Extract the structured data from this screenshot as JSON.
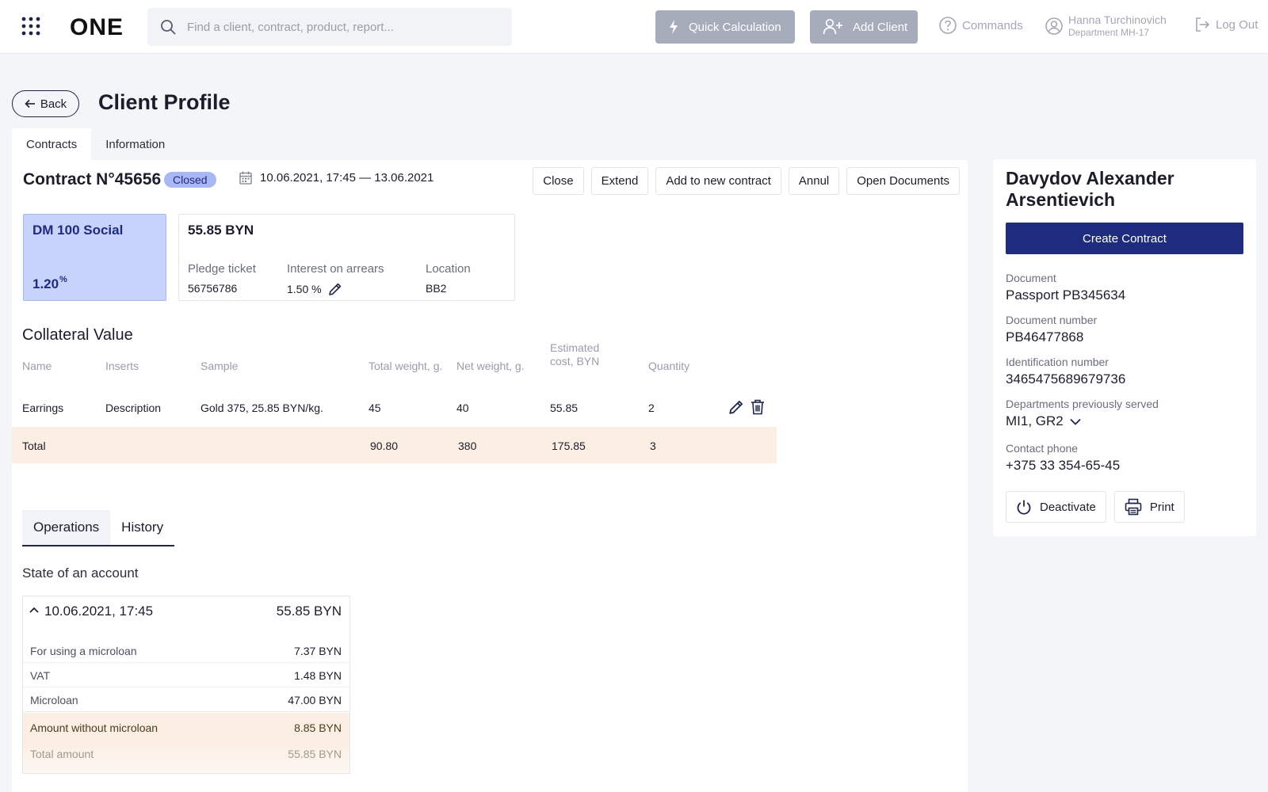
{
  "header": {
    "logo": "ONE",
    "search_placeholder": "Find a client, contract, product, report...",
    "quick_calc": "Quick Calculation",
    "add_client": "Add Client",
    "commands": "Commands",
    "user_name": "Hanna Turchinovich",
    "user_dept": "Department MH-17",
    "logout": "Log Out"
  },
  "page": {
    "back": "Back",
    "title": "Client Profile",
    "tabs": [
      "Contracts",
      "Information"
    ]
  },
  "contract": {
    "title": "Contract N°45656",
    "status": "Closed",
    "dates": "10.06.2021, 17:45 — 13.06.2021",
    "actions": [
      "Close",
      "Extend",
      "Add to new contract",
      "Annul",
      "Open Documents"
    ],
    "product_name": "DM 100 Social",
    "product_rate": "1.20",
    "product_rate_unit": "%",
    "amount": "55.85 BYN",
    "pledge_label": "Pledge ticket",
    "pledge_value": "56756786",
    "interest_label": "Interest on arrears",
    "interest_value": "1.50 %",
    "location_label": "Location",
    "location_value": "BB2"
  },
  "collateral": {
    "title": "Collateral Value",
    "columns": [
      "Name",
      "Inserts",
      "Sample",
      "Total weight, g.",
      "Net weight, g.",
      "Estimated",
      "cost, BYN",
      "Quantity"
    ],
    "rows": [
      {
        "name": "Earrings",
        "inserts": "Description",
        "sample": "Gold 375, 25.85 BYN/kg.",
        "total_weight": "45",
        "net_weight": "40",
        "cost": "55.85",
        "quantity": "2"
      }
    ],
    "total": {
      "label": "Total",
      "total_weight": "90.80",
      "net_weight": "380",
      "cost": "175.85",
      "quantity": "3"
    }
  },
  "operations": {
    "tabs": [
      "Operations",
      "History"
    ],
    "state_title": "State of an account",
    "entry_date": "10.06.2021, 17:45",
    "entry_amount": "55.85 BYN",
    "lines": [
      {
        "label": "For using a microloan",
        "value": "7.37 BYN"
      },
      {
        "label": "VAT",
        "value": "1.48 BYN"
      },
      {
        "label": "Microloan",
        "value": "47.00 BYN"
      },
      {
        "label": "Amount without microloan",
        "value": "8.85 BYN"
      },
      {
        "label": "Total amount",
        "value": "55.85 BYN"
      }
    ]
  },
  "client": {
    "name": "Davydov Alexander Arsentievich",
    "create_contract": "Create Contract",
    "fields": [
      {
        "label": "Document",
        "value": "Passport PB345634"
      },
      {
        "label": "Document number",
        "value": "PB46477868"
      },
      {
        "label": "Identification number",
        "value": "3465475689679736"
      },
      {
        "label": "Departments previously served",
        "value": "MI1, GR2"
      },
      {
        "label": "Contact phone",
        "value": "+375 33 354-65-45"
      }
    ],
    "deactivate": "Deactivate",
    "print": "Print"
  },
  "colors": {
    "accent": "#1f2c7d",
    "status_bg": "#a9b8f5",
    "highlight_row": "#fbeee3",
    "header_button": "#a7acbb"
  },
  "icons": [
    "apps-grid-icon",
    "search-icon",
    "lightning-icon",
    "add-user-icon",
    "help-icon",
    "user-icon",
    "logout-icon",
    "arrow-left-icon",
    "calendar-icon",
    "pencil-icon",
    "trash-icon",
    "chevron-up-icon",
    "chevron-down-icon",
    "power-icon",
    "printer-icon"
  ]
}
